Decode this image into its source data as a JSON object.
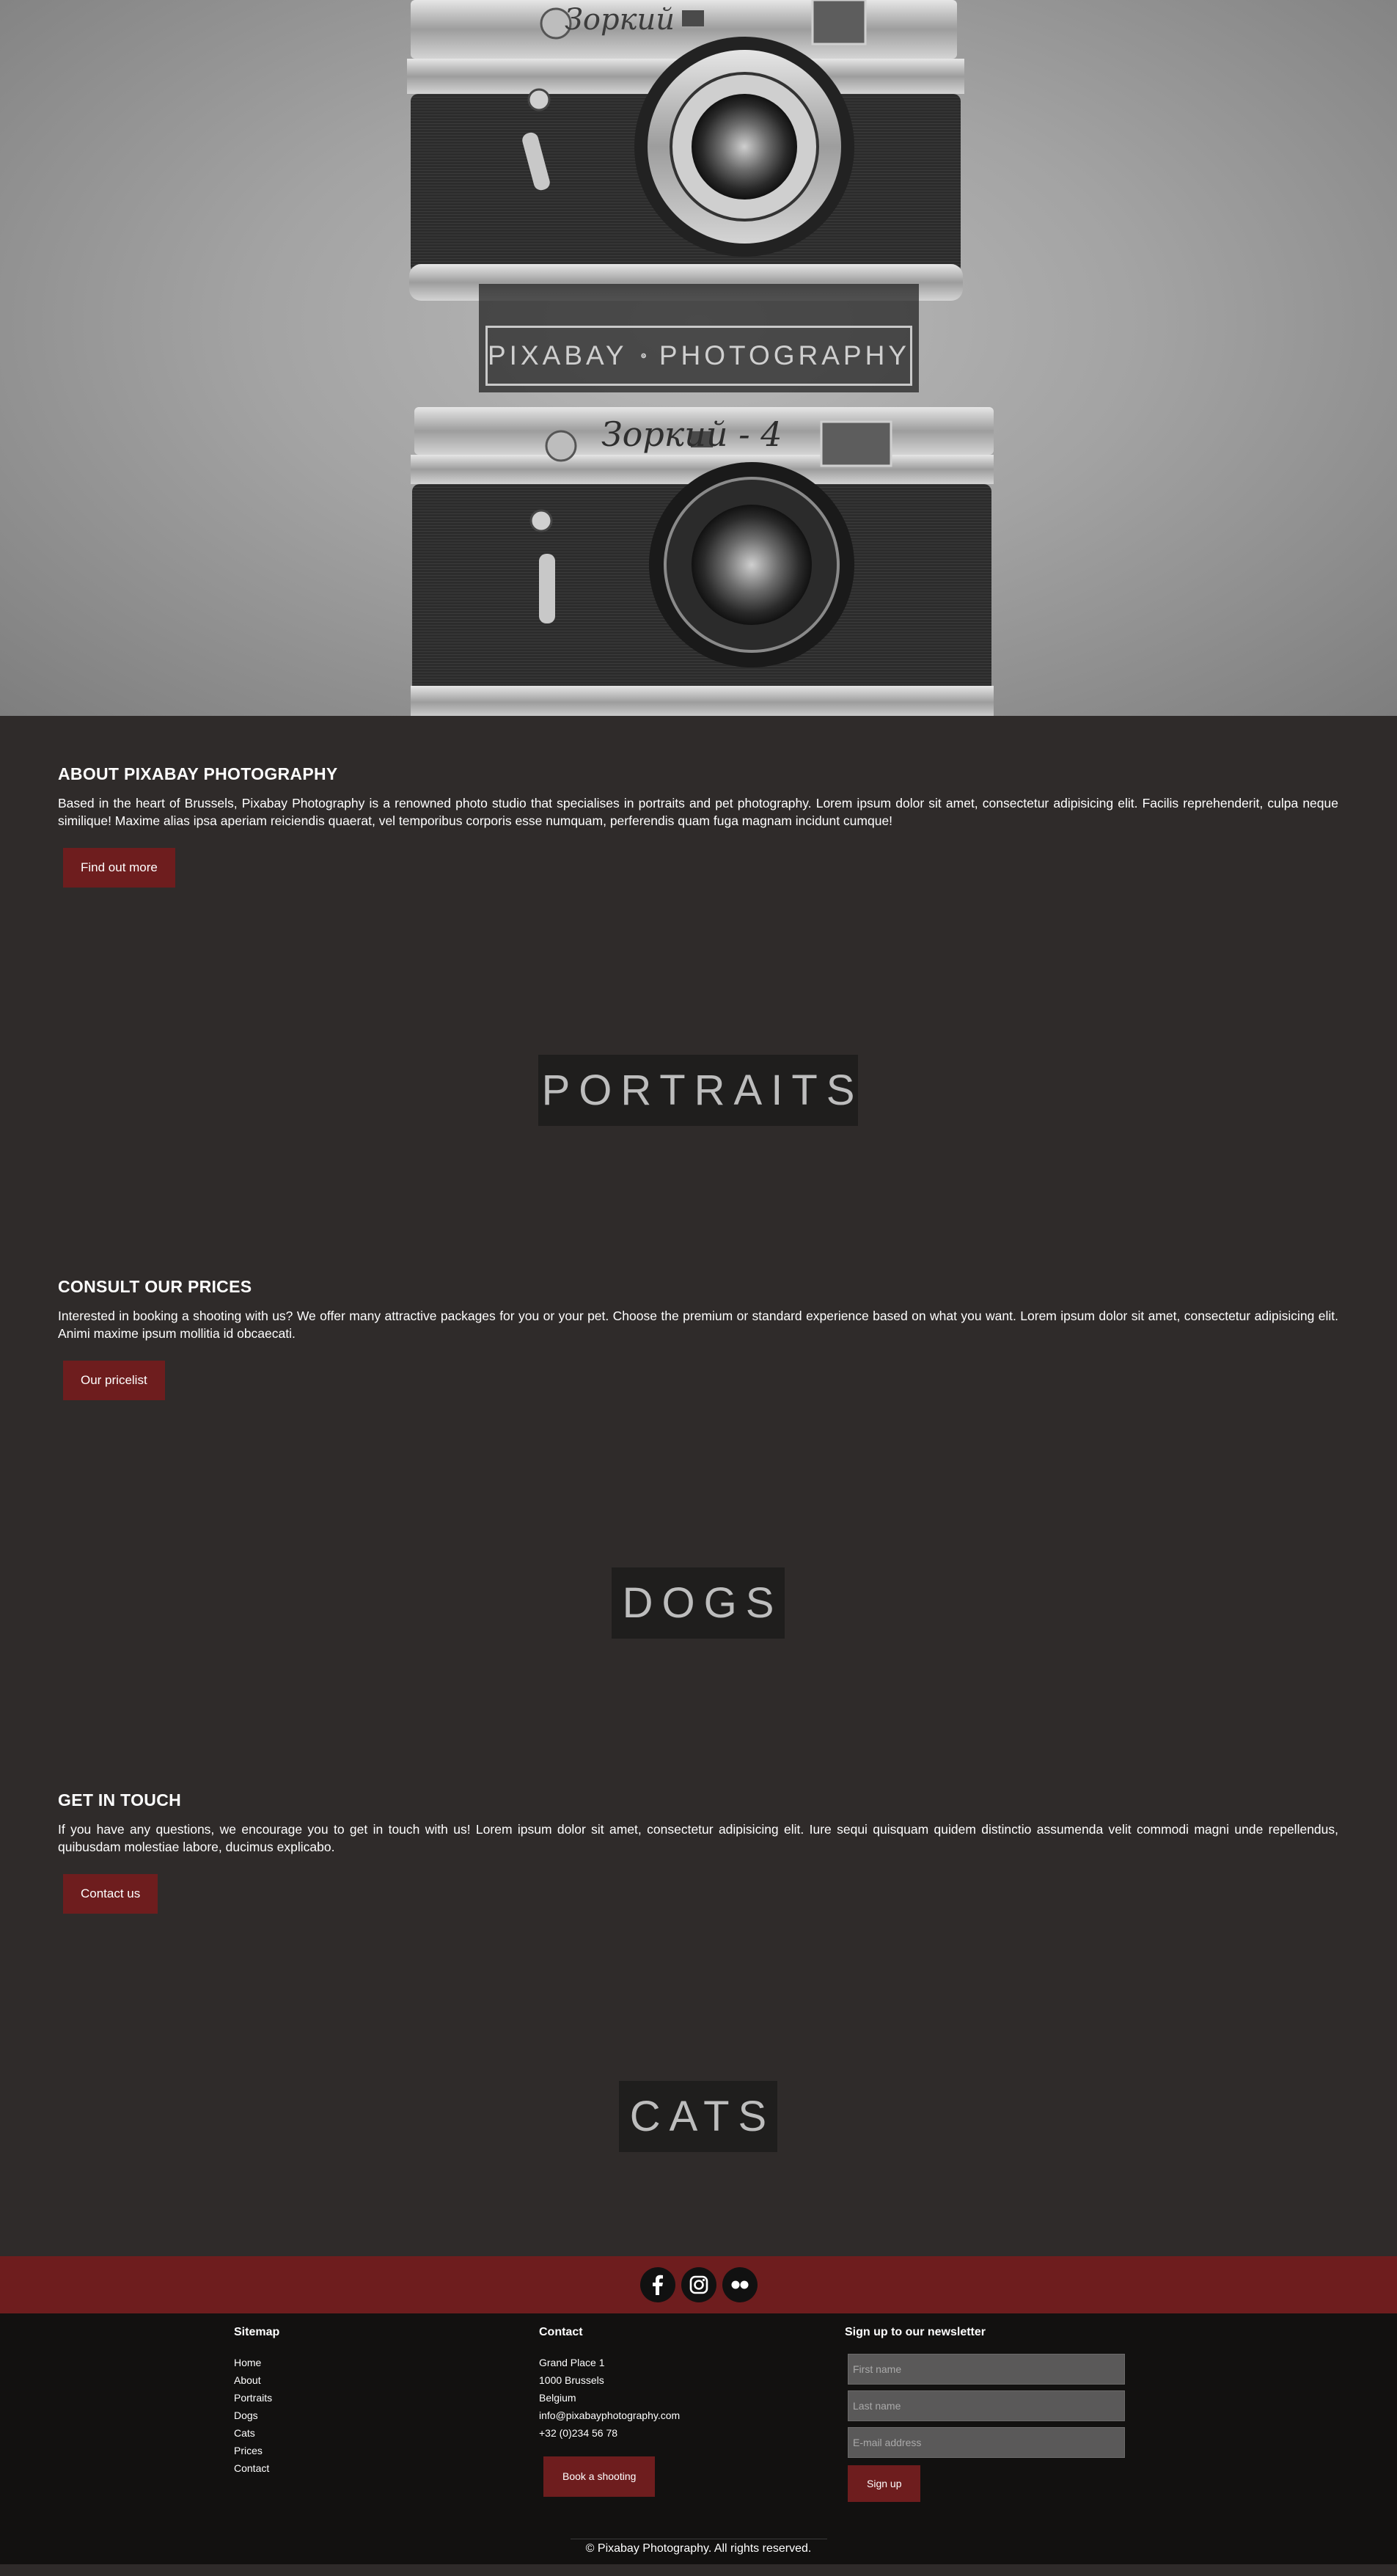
{
  "hero": {
    "logo_left": "PIXABAY",
    "logo_right": "PHOTOGRAPHY",
    "camera_top_script": "Зоркий",
    "camera_bottom_script": "Зоркий - 4"
  },
  "about": {
    "title": "ABOUT PIXABAY PHOTOGRAPHY",
    "text": "Based in the heart of Brussels, Pixabay Photography is a renowned photo studio that specialises in portraits and pet photography. Lorem ipsum dolor sit amet, consectetur adipisicing elit. Facilis reprehenderit, culpa neque similique! Maxime alias ipsa aperiam reiciendis quaerat, vel temporibus corporis esse numquam, perferendis quam fuga magnam incidunt cumque!",
    "button": "Find out more"
  },
  "banners": {
    "portraits": "PORTRAITS",
    "dogs": "DOGS",
    "cats": "CATS"
  },
  "prices": {
    "title": "CONSULT OUR PRICES",
    "text": "Interested in booking a shooting with us? We offer many attractive packages for you or your pet. Choose the premium or standard experience based on what you want. Lorem ipsum dolor sit amet, consectetur adipisicing elit. Animi maxime ipsum mollitia id obcaecati.",
    "button": "Our pricelist"
  },
  "contact_section": {
    "title": "GET IN TOUCH",
    "text": "If you have any questions, we encourage you to get in touch with us! Lorem ipsum dolor sit amet, consectetur adipisicing elit. Iure sequi quisquam quidem distinctio assumenda velit commodi magni unde repellendus, quibusdam molestiae labore, ducimus explicabo.",
    "button": "Contact us"
  },
  "social": [
    "facebook-icon",
    "instagram-icon",
    "flickr-icon"
  ],
  "footer": {
    "sitemap": {
      "title": "Sitemap",
      "items": [
        "Home",
        "About",
        "Portraits",
        "Dogs",
        "Cats",
        "Prices",
        "Contact"
      ]
    },
    "contact": {
      "title": "Contact",
      "lines": [
        "Grand Place 1",
        "1000 Brussels",
        "Belgium",
        "info@pixabayphotography.com",
        "+32 (0)234 56 78"
      ],
      "button": "Book a shooting"
    },
    "newsletter": {
      "title": "Sign up to our newsletter",
      "first_name_placeholder": "First name",
      "last_name_placeholder": "Last name",
      "email_placeholder": "E-mail address",
      "button": "Sign up"
    },
    "copyright": "© Pixabay Photography. All rights reserved."
  },
  "colors": {
    "accent": "#6e1d1e",
    "background": "#2f2b2a",
    "footer": "#121110",
    "banner": "#1f1e1d"
  }
}
